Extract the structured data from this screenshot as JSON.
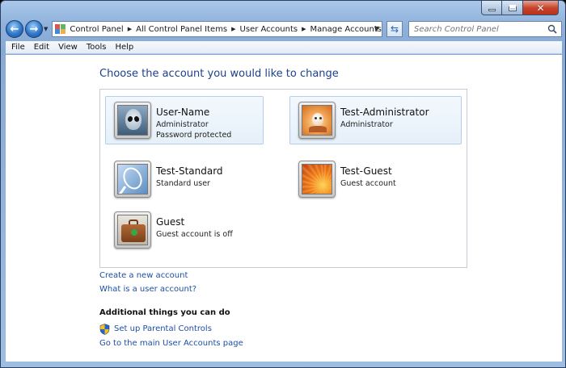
{
  "window": {
    "caption_buttons": {
      "minimize": "minimize-icon",
      "maximize": "maximize-icon",
      "close": "close-icon"
    }
  },
  "navigation": {
    "back_icon": "back-arrow-icon",
    "forward_icon": "forward-arrow-icon",
    "breadcrumbs": [
      "Control Panel",
      "All Control Panel Items",
      "User Accounts",
      "Manage Accounts"
    ],
    "refresh_icon": "refresh-icon",
    "search": {
      "placeholder": "Search Control Panel",
      "icon": "search-icon"
    }
  },
  "menu": {
    "items": [
      {
        "label": "File"
      },
      {
        "label": "Edit"
      },
      {
        "label": "View"
      },
      {
        "label": "Tools"
      },
      {
        "label": "Help"
      }
    ]
  },
  "main": {
    "heading": "Choose the account you would like to change",
    "accounts": [
      {
        "name": "User-Name",
        "lines": [
          "Administrator",
          "Password protected"
        ],
        "avatar": "alien-avatar",
        "selected": true
      },
      {
        "name": "Test-Administrator",
        "lines": [
          "Administrator"
        ],
        "avatar": "chess-piece-avatar",
        "selected": true
      },
      {
        "name": "Test-Standard",
        "lines": [
          "Standard user"
        ],
        "avatar": "tennis-racket-avatar",
        "selected": false
      },
      {
        "name": "Test-Guest",
        "lines": [
          "Guest account"
        ],
        "avatar": "orange-flower-avatar",
        "selected": false
      },
      {
        "name": "Guest",
        "lines": [
          "Guest account is off"
        ],
        "avatar": "briefcase-avatar",
        "selected": false
      }
    ],
    "links": {
      "create_account": "Create a new account",
      "what_is_account": "What is a user account?"
    },
    "additional": {
      "heading": "Additional things you can do",
      "parental_controls": "Set up Parental Controls",
      "main_page": "Go to the main User Accounts page"
    }
  },
  "colors": {
    "heading": "#1e3f8c",
    "link": "#1e4fa3",
    "frame": "#8fb2dc",
    "tile_highlight": "#e6f0fa"
  }
}
